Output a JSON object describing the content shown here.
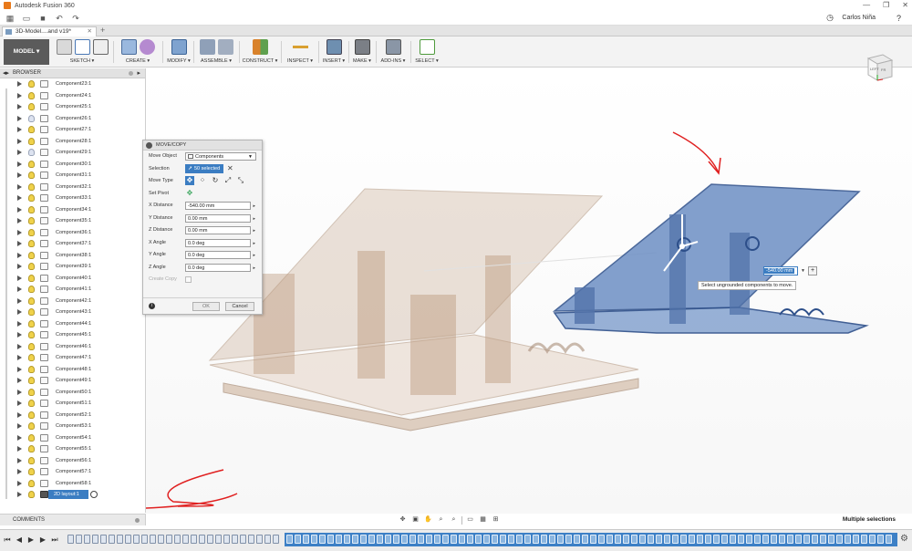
{
  "app": {
    "title": "Autodesk Fusion 360",
    "user": "Carlos Niña"
  },
  "tabs": [
    {
      "label": "3D-Model....and v19*"
    }
  ],
  "toolbar": {
    "workspace": "MODEL",
    "groups": [
      {
        "label": "SKETCH ▾"
      },
      {
        "label": "CREATE ▾"
      },
      {
        "label": "MODIFY ▾"
      },
      {
        "label": "ASSEMBLE ▾"
      },
      {
        "label": "CONSTRUCT ▾"
      },
      {
        "label": "INSPECT ▾"
      },
      {
        "label": "INSERT ▾"
      },
      {
        "label": "MAKE ▾"
      },
      {
        "label": "ADD-INS ▾"
      },
      {
        "label": "SELECT ▾"
      }
    ]
  },
  "browser": {
    "title": "BROWSER",
    "items": [
      {
        "label": "Component23:1"
      },
      {
        "label": "Component24:1"
      },
      {
        "label": "Component25:1"
      },
      {
        "label": "Component26:1"
      },
      {
        "label": "Component27:1"
      },
      {
        "label": "Component28:1"
      },
      {
        "label": "Component29:1"
      },
      {
        "label": "Component30:1"
      },
      {
        "label": "Component31:1"
      },
      {
        "label": "Component32:1"
      },
      {
        "label": "Component33:1"
      },
      {
        "label": "Component34:1"
      },
      {
        "label": "Component35:1"
      },
      {
        "label": "Component36:1"
      },
      {
        "label": "Component37:1"
      },
      {
        "label": "Component38:1"
      },
      {
        "label": "Component39:1"
      },
      {
        "label": "Component40:1"
      },
      {
        "label": "Component41:1"
      },
      {
        "label": "Component42:1"
      },
      {
        "label": "Component43:1"
      },
      {
        "label": "Component44:1"
      },
      {
        "label": "Component45:1"
      },
      {
        "label": "Component46:1"
      },
      {
        "label": "Component47:1"
      },
      {
        "label": "Component48:1"
      },
      {
        "label": "Component49:1"
      },
      {
        "label": "Component50:1"
      },
      {
        "label": "Component51:1"
      },
      {
        "label": "Component52:1"
      },
      {
        "label": "Component53:1"
      },
      {
        "label": "Component54:1"
      },
      {
        "label": "Component55:1"
      },
      {
        "label": "Component56:1"
      },
      {
        "label": "Component57:1"
      },
      {
        "label": "Component58:1"
      }
    ],
    "active_item": "2D layout:1"
  },
  "comments": {
    "label": "COMMENTS"
  },
  "dialog": {
    "title": "MOVE/COPY",
    "move_object_label": "Move Object",
    "move_object_value": "Components",
    "selection_label": "Selection",
    "selection_value": "50 selected",
    "move_type_label": "Move Type",
    "set_pivot_label": "Set Pivot",
    "fields": [
      {
        "label": "X Distance",
        "value": "-540.00 mm"
      },
      {
        "label": "Y Distance",
        "value": "0.00 mm"
      },
      {
        "label": "Z Distance",
        "value": "0.00 mm"
      },
      {
        "label": "X Angle",
        "value": "0.0 deg"
      },
      {
        "label": "Y Angle",
        "value": "0.0 deg"
      },
      {
        "label": "Z Angle",
        "value": "0.0 deg"
      }
    ],
    "create_copy_label": "Create Copy",
    "ok_label": "OK",
    "cancel_label": "Cancel"
  },
  "viewport": {
    "distance_input": "-540.00 mm",
    "tooltip": "Select ungrounded components to move.",
    "status": "Multiple selections"
  },
  "viewcube": {
    "left": "LEFT",
    "front": "FR"
  },
  "colors": {
    "accent": "#3b7dc2",
    "model_ghost": "#c9a991",
    "model_selected": "#5a80b8",
    "annotation": "#e02020"
  }
}
